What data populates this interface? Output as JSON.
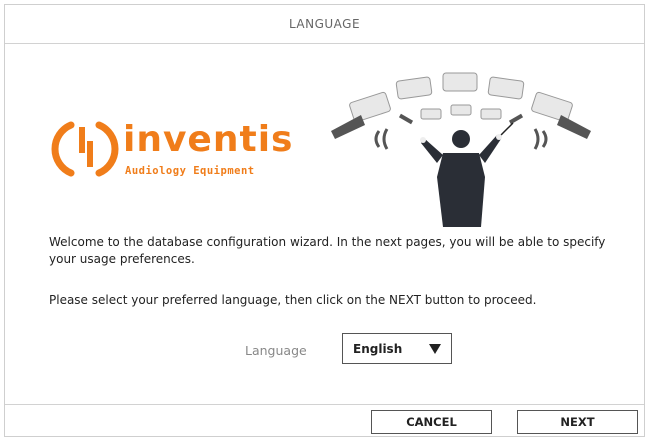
{
  "window": {
    "title": "LANGUAGE"
  },
  "logo": {
    "brand": "inventis",
    "tagline": "Audiology Equipment",
    "color": "#f07d1a"
  },
  "content": {
    "welcome_text": "Welcome to the database configuration wizard. In the next pages, you will be able to specify your usage preferences.",
    "instruction_text": "Please select your preferred language, then click on the NEXT button to proceed."
  },
  "language": {
    "label": "Language",
    "selected": "English"
  },
  "buttons": {
    "cancel": "CANCEL",
    "next": "NEXT"
  }
}
